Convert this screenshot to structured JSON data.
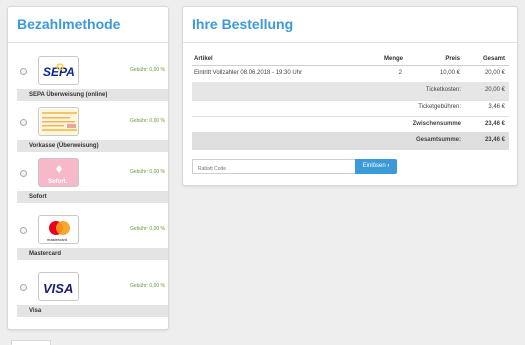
{
  "payment": {
    "title": "Bezahlmethode",
    "options": [
      {
        "name": "SEPA Überweisung (online)",
        "fee": "Gebühr: 0,00 %",
        "logo_text": "SEPA"
      },
      {
        "name": "Vorkasse (Überweisung)",
        "fee": "Gebühr: 0,00 %",
        "logo_text": ""
      },
      {
        "name": "Sofort",
        "fee": "Gebühr: 0,00 %",
        "logo_text": "Sofort."
      },
      {
        "name": "Mastercard",
        "fee": "Gebühr: 0,00 %",
        "logo_text": "mastercard"
      },
      {
        "name": "Visa",
        "fee": "Gebühr: 0,00 %",
        "logo_text": "VISA"
      }
    ]
  },
  "order": {
    "title": "Ihre Bestellung",
    "columns": {
      "article": "Artikel",
      "quantity": "Menge",
      "price": "Preis",
      "total": "Gesamt"
    },
    "items": [
      {
        "article": "Eintritt Vollzahler 08.06.2018 - 19:30 Uhr",
        "quantity": "2",
        "price": "10,00 €",
        "total": "20,00 €"
      }
    ],
    "summary": {
      "ticket_costs_label": "Ticketkosten:",
      "ticket_costs_value": "20,00 €",
      "ticket_fees_label": "Ticketgebühren:",
      "ticket_fees_value": "3,46 €",
      "subtotal_label": "Zwischensumme",
      "subtotal_value": "23,46 €",
      "grand_total_label": "Gesamtsumme:",
      "grand_total_value": "23,46 €"
    },
    "coupon": {
      "placeholder": "Rabatt Code",
      "button_label": "Einlösen",
      "button_icon": "chevron-right-icon"
    }
  },
  "colors": {
    "accent": "#3d9ad8",
    "fee": "#6a9a3a",
    "band": "#e4e4e4"
  }
}
